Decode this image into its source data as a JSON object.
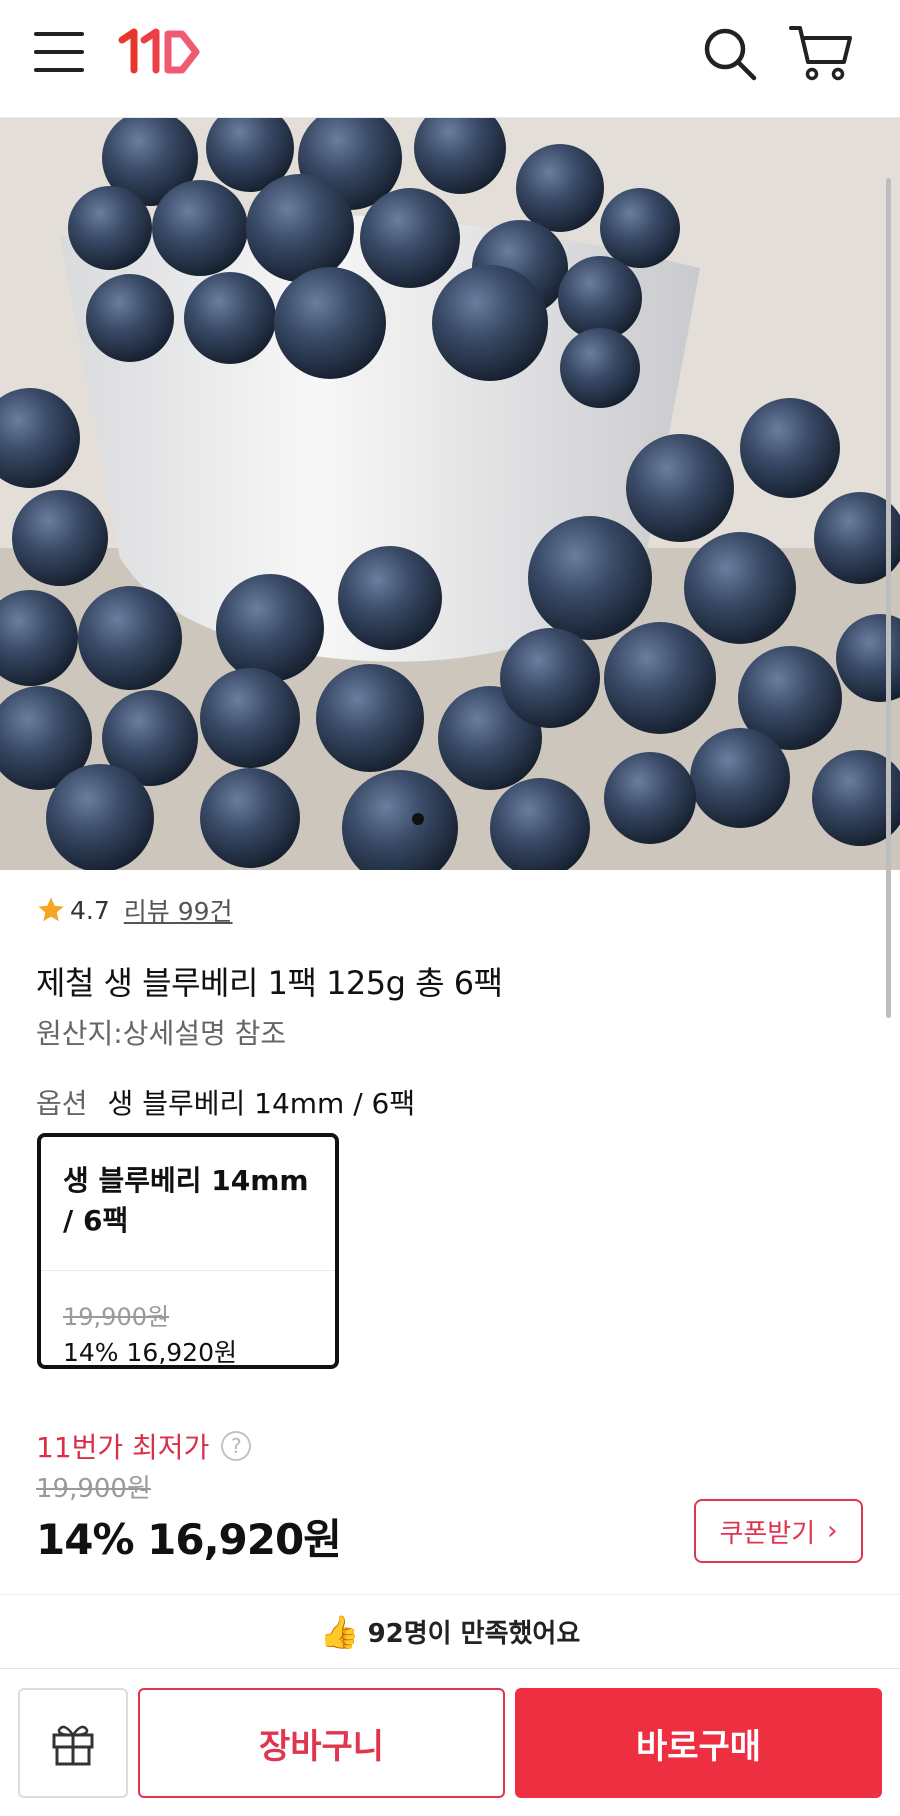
{
  "header": {
    "logo_text": "11",
    "logo_colors": [
      "#e8362d",
      "#f05a72"
    ],
    "icons": [
      "menu-icon",
      "search-icon",
      "cart-icon"
    ]
  },
  "hero": {
    "image_subject": "blueberries in a white bowl",
    "carousel_dots": 1
  },
  "product": {
    "rating": "4.7",
    "review_link": "리뷰 99건",
    "title": "제철 생 블루베리 1팩 125g 총 6팩",
    "origin": "원산지:상세설명 참조"
  },
  "option": {
    "label": "옵션",
    "value": "생 블루베리 14mm / 6팩",
    "card": {
      "name": "생 블루베리 14mm / 6팩",
      "original_price": "19,900원",
      "sale_price": "14% 16,920원"
    }
  },
  "price": {
    "lowest_label": "11번가 최저가",
    "help": "?",
    "original": "19,900원",
    "sale": "14% 16,920원",
    "coupon_button": "쿠폰받기",
    "coupon_chevron": "›",
    "accent": "#e0354f"
  },
  "satisfaction": {
    "icon": "👍",
    "text": "92명이 만족했어요"
  },
  "bottom_bar": {
    "gift_icon": "gift-icon",
    "cart_button": "장바구니",
    "buy_button": "바로구매",
    "buy_color": "#ee2f42"
  }
}
